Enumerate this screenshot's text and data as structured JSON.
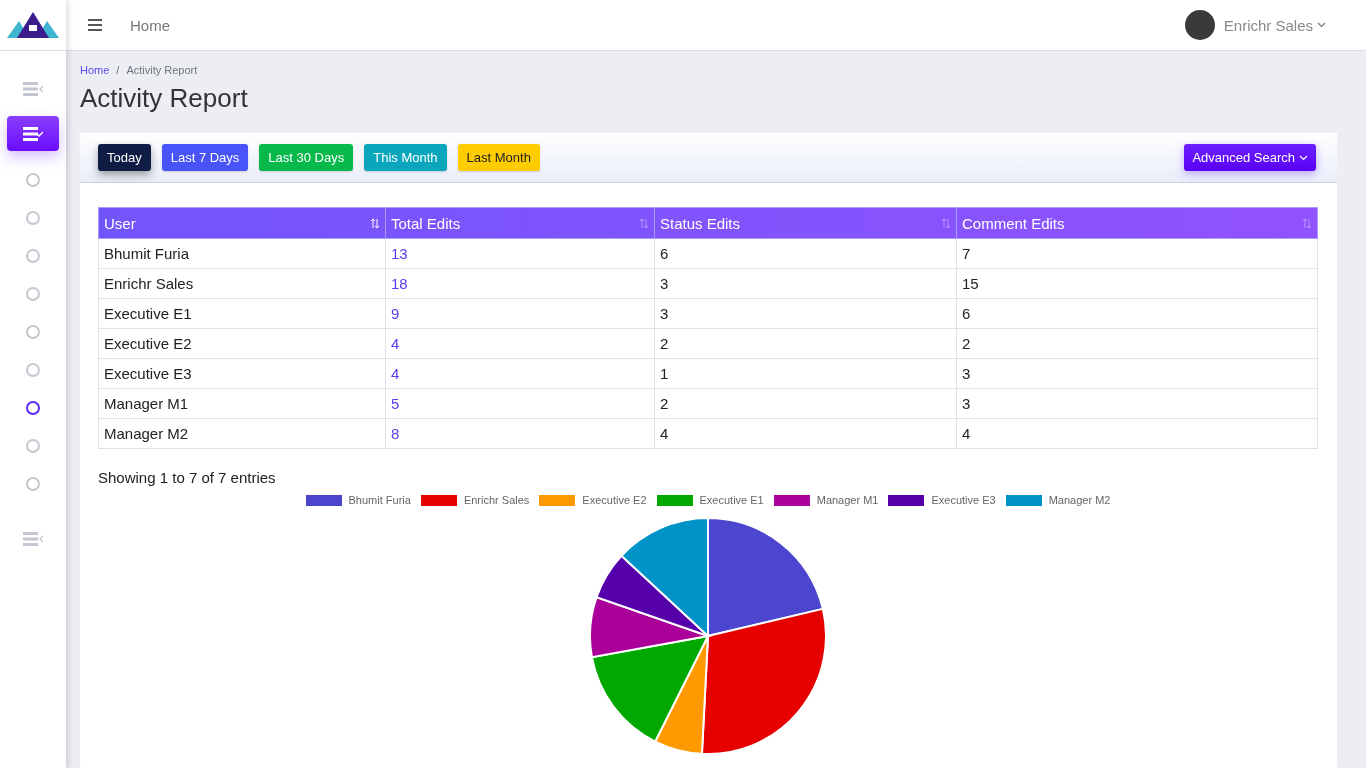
{
  "header": {
    "nav_link": "Home",
    "user_name": "Enrichr Sales"
  },
  "sidebar": {
    "items": [
      {
        "kind": "menu",
        "selected": false
      },
      {
        "kind": "menu",
        "selected": true
      },
      {
        "kind": "circle",
        "selected": false
      },
      {
        "kind": "circle",
        "selected": false
      },
      {
        "kind": "circle",
        "selected": false
      },
      {
        "kind": "circle",
        "selected": false
      },
      {
        "kind": "circle",
        "selected": false
      },
      {
        "kind": "circle",
        "selected": false
      },
      {
        "kind": "circle",
        "selected": true
      },
      {
        "kind": "circle",
        "selected": false
      },
      {
        "kind": "circle",
        "selected": false
      },
      {
        "kind": "menu",
        "selected": false
      }
    ]
  },
  "breadcrumb": [
    {
      "label": "Home",
      "link": true
    },
    {
      "label": "Activity Report",
      "link": false
    }
  ],
  "breadcrumb_separator": "/",
  "page_title": "Activity Report",
  "filters": [
    {
      "label": "Today",
      "color": "#0f1d45"
    },
    {
      "label": "Last 7 Days",
      "color": "#4853f8"
    },
    {
      "label": "Last 30 Days",
      "color": "#06b94a"
    },
    {
      "label": "This Month",
      "color": "#0aa7bc"
    },
    {
      "label": "Last Month",
      "color": "#ffcc00"
    }
  ],
  "advanced_search": "Advanced Search",
  "table": {
    "columns": [
      {
        "label": "User",
        "sorted": true
      },
      {
        "label": "Total Edits",
        "sorted": false
      },
      {
        "label": "Status Edits",
        "sorted": false
      },
      {
        "label": "Comment Edits",
        "sorted": false
      }
    ],
    "rows": [
      [
        "Bhumit Furia",
        "13",
        "6",
        "7"
      ],
      [
        "Enrichr Sales",
        "18",
        "3",
        "15"
      ],
      [
        "Executive E1",
        "9",
        "3",
        "6"
      ],
      [
        "Executive E2",
        "4",
        "2",
        "2"
      ],
      [
        "Executive E3",
        "4",
        "1",
        "3"
      ],
      [
        "Manager M1",
        "5",
        "2",
        "3"
      ],
      [
        "Manager M2",
        "8",
        "4",
        "4"
      ]
    ]
  },
  "table_info": "Showing 1 to 7 of 7 entries",
  "chart_data": {
    "type": "pie",
    "categories": [
      "Bhumit Furia",
      "Enrichr Sales",
      "Executive E2",
      "Executive E1",
      "Manager M1",
      "Executive E3",
      "Manager M2"
    ],
    "colors": [
      "#4b45d0",
      "#e60000",
      "#ff9900",
      "#00a800",
      "#aa0099",
      "#5500aa",
      "#0093c8"
    ],
    "values": [
      21.31,
      29.51,
      6.56,
      14.75,
      8.2,
      6.56,
      13.11
    ],
    "legend": true
  }
}
